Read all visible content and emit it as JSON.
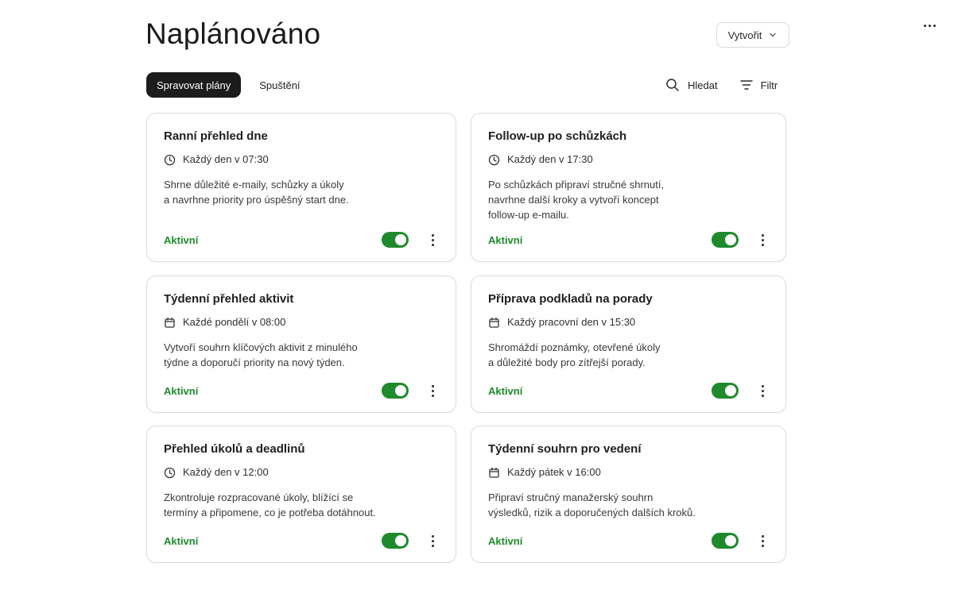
{
  "header": {
    "title": "Naplánováno",
    "create_label": "Vytvořit",
    "more_icon": "more-horizontal-icon"
  },
  "tabs": [
    {
      "label": "Spravovat plány",
      "active": true
    },
    {
      "label": "Spuštění",
      "active": false
    }
  ],
  "tools": {
    "search_label": "Hledat",
    "filter_label": "Filtr"
  },
  "colors": {
    "accent_green": "#1f8a2c",
    "tab_active_bg": "#1c1c1c"
  },
  "cards": [
    {
      "title": "Ranní přehled dne",
      "schedule": "Každý den v 07:30",
      "schedule_icon": "clock-icon",
      "desc_line1": "Shrne důležité e-maily, schůzky a úkoly",
      "desc_line2": "a navrhne priority pro úspěšný start dne.",
      "desc_line3": "",
      "status": "Aktivní",
      "enabled": true
    },
    {
      "title": "Follow-up po schůzkách",
      "schedule": "Každý den v 17:30",
      "schedule_icon": "clock-icon",
      "desc_line1": "Po schůzkách připraví stručné shrnutí,",
      "desc_line2": "navrhne další kroky a vytvoří koncept",
      "desc_line3": "follow-up e-mailu.",
      "status": "Aktivní",
      "enabled": true
    },
    {
      "title": "Týdenní přehled aktivit",
      "schedule": "Každé pondělí v 08:00",
      "schedule_icon": "calendar-icon",
      "desc_line1": "Vytvoří souhrn klíčových aktivit z minulého",
      "desc_line2": "týdne a doporučí priority na nový týden.",
      "desc_line3": "",
      "status": "Aktivní",
      "enabled": true
    },
    {
      "title": "Příprava podkladů na porady",
      "schedule": "Každý pracovní den v 15:30",
      "schedule_icon": "calendar-icon",
      "desc_line1": "Shromáždí poznámky, otevřené úkoly",
      "desc_line2": "a důležité body pro zítřejší porady.",
      "desc_line3": "",
      "status": "Aktivní",
      "enabled": true
    },
    {
      "title": "Přehled úkolů a deadlinů",
      "schedule": "Každý den v 12:00",
      "schedule_icon": "clock-icon",
      "desc_line1": "Zkontroluje rozpracované úkoly, blížící se",
      "desc_line2": "termíny a připomene, co je potřeba dotáhnout.",
      "desc_line3": "",
      "status": "Aktivní",
      "enabled": true
    },
    {
      "title": "Týdenní souhrn pro vedení",
      "schedule": "Každý pátek v 16:00",
      "schedule_icon": "calendar-icon",
      "desc_line1": "Připraví stručný manažerský souhrn",
      "desc_line2": "výsledků, rizik a doporučených dalších kroků.",
      "desc_line3": "",
      "status": "Aktivní",
      "enabled": true
    }
  ]
}
